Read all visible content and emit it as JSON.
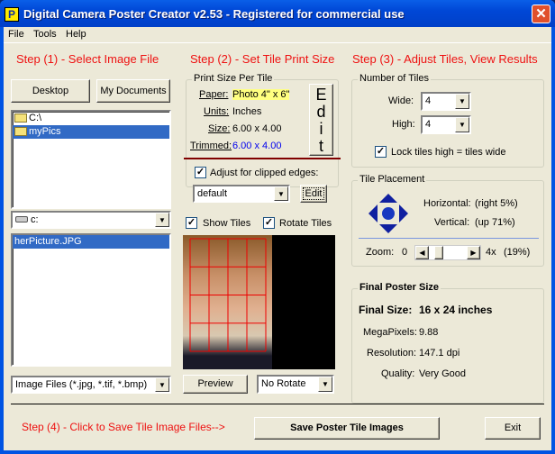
{
  "window": {
    "title": "Digital Camera Poster Creator v2.53 - Registered for commercial use",
    "app_icon_letter": "P",
    "close_glyph": "✕"
  },
  "menu": [
    {
      "label": "File"
    },
    {
      "label": "Tools"
    },
    {
      "label": "Help"
    }
  ],
  "steps": {
    "step1": "Step (1) - Select Image File",
    "step2": "Step (2) - Set Tile Print Size",
    "step3": "Step (3) - Adjust Tiles, View Results",
    "step4": "Step (4) - Click to Save Tile Image Files-->"
  },
  "step1": {
    "desktop_button": "Desktop",
    "documents_button": "My Documents",
    "folders": [
      {
        "label": "C:\\",
        "selected": false
      },
      {
        "label": "myPics",
        "selected": true
      }
    ],
    "drive": "c:",
    "files": [
      {
        "label": "herPicture.JPG",
        "selected": true
      }
    ],
    "file_filter": "Image Files (*.jpg, *.tif, *.bmp)"
  },
  "step2": {
    "group_title": "Print Size Per Tile",
    "paper_label": "Paper:",
    "paper_value": "Photo 4\" x 6\"",
    "units_label": "Units:",
    "units_value": "Inches",
    "size_label": "Size:",
    "size_value": "6.00 x 4.00",
    "trimmed_label": "Trimmed:",
    "trimmed_value": "6.00 x 4.00",
    "edit_vertical": [
      "E",
      "d",
      "i",
      "t"
    ],
    "adjust_label": "Adjust for clipped edges:",
    "adjust_checked": true,
    "adjust_preset": "default",
    "adjust_edit": "Edit",
    "show_tiles_label": "Show Tiles",
    "show_tiles_checked": true,
    "rotate_tiles_label": "Rotate Tiles",
    "rotate_tiles_checked": true,
    "preview_button": "Preview",
    "rotate_option": "No Rotate"
  },
  "step3": {
    "tiles_group": "Number of Tiles",
    "wide_label": "Wide:",
    "wide_value": "4",
    "high_label": "High:",
    "high_value": "4",
    "lock_label": "Lock tiles high = tiles wide",
    "lock_checked": true,
    "placement_group": "Tile Placement",
    "horizontal_label": "Horizontal:",
    "horizontal_value": "(right 5%)",
    "vertical_label": "Vertical:",
    "vertical_value": "(up 71%)",
    "zoom_label": "Zoom:",
    "zoom_min": "0",
    "zoom_max": "4x",
    "zoom_value": "(19%)",
    "zoom_fraction": 0.19,
    "final_group": "Final Poster Size",
    "final_size_label": "Final Size:",
    "final_size_value": "16 x 24 inches",
    "megapixels_label": "MegaPixels:",
    "megapixels_value": "9.88",
    "resolution_label": "Resolution:",
    "resolution_value": "147.1 dpi",
    "quality_label": "Quality:",
    "quality_value": "Very Good"
  },
  "footer": {
    "save_button": "Save Poster Tile Images",
    "exit_button": "Exit"
  },
  "colors": {
    "step_red": "#ee1111",
    "selection_blue": "#316ac5",
    "tile_grid_red": "#ee0000",
    "paper_highlight": "#ffff80",
    "trimmed_blue": "#0000ee"
  }
}
